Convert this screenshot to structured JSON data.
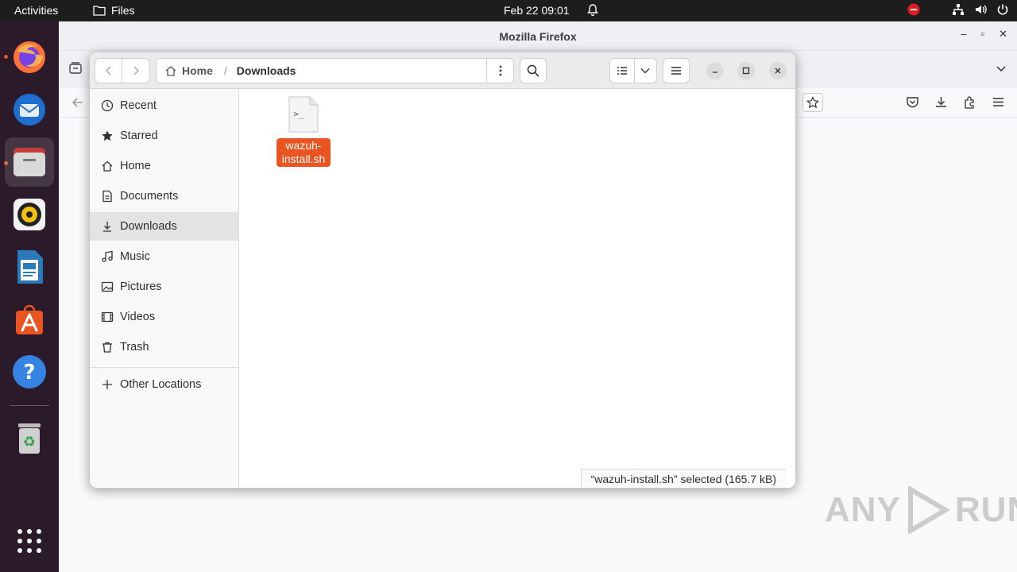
{
  "topbar": {
    "activities": "Activities",
    "app_name": "Files",
    "clock": "Feb 22  09:01"
  },
  "firefox": {
    "title": "Mozilla Firefox"
  },
  "files": {
    "path_home": "Home",
    "path_current": "Downloads",
    "sidebar": [
      {
        "label": "Recent",
        "icon": "clock-icon"
      },
      {
        "label": "Starred",
        "icon": "star-icon"
      },
      {
        "label": "Home",
        "icon": "home-icon"
      },
      {
        "label": "Documents",
        "icon": "document-icon"
      },
      {
        "label": "Downloads",
        "icon": "download-icon"
      },
      {
        "label": "Music",
        "icon": "music-icon"
      },
      {
        "label": "Pictures",
        "icon": "pictures-icon"
      },
      {
        "label": "Videos",
        "icon": "videos-icon"
      },
      {
        "label": "Trash",
        "icon": "trash-icon"
      }
    ],
    "other_locations": "Other Locations",
    "file_name_line1": "wazuh-",
    "file_name_line2": "install.sh",
    "file_icon_glyph": ">_",
    "status": "“wazuh-install.sh” selected  (165.7 kB)"
  },
  "watermark": {
    "left": "ANY",
    "right": "RUN"
  },
  "colors": {
    "accent": "#e95420",
    "topbar": "#1d1d1d",
    "dock": "#2b1b2a"
  }
}
